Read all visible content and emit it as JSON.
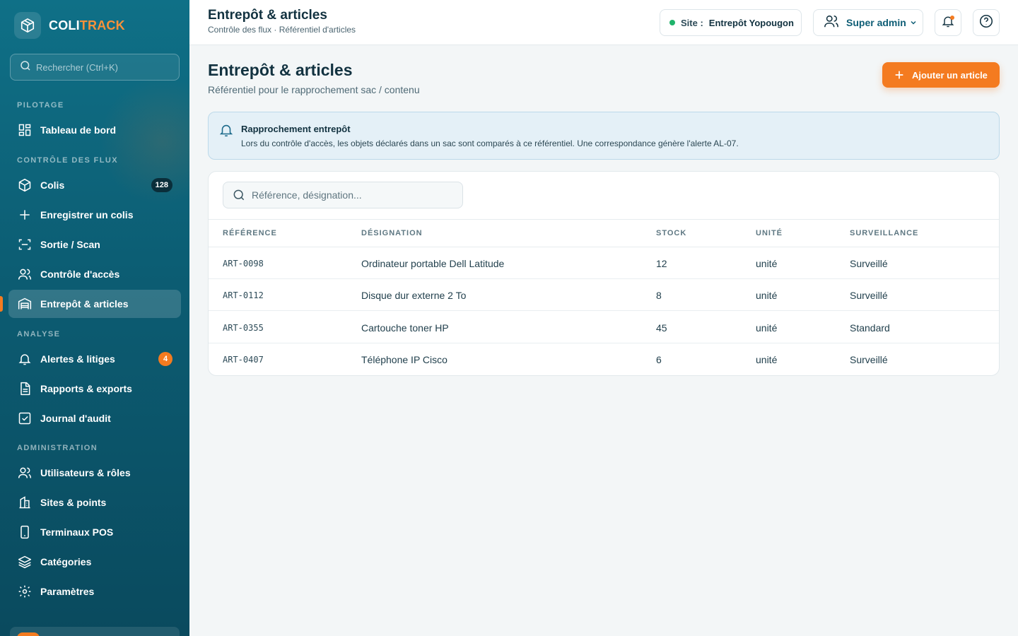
{
  "brand": {
    "name_part1": "COLI",
    "name_part2": "TRACK",
    "accent": "#f47b20"
  },
  "sidebar": {
    "search_placeholder": "Rechercher (Ctrl+K)",
    "sections": [
      "PILOTAGE",
      "CONTRÔLE DES FLUX",
      "ANALYSE",
      "ADMINISTRATION"
    ],
    "items": [
      {
        "label": "Tableau de bord",
        "icon": "dashboard-icon"
      },
      {
        "label": "Colis",
        "icon": "package-icon",
        "badge": "128"
      },
      {
        "label": "Enregistrer un colis",
        "icon": "plus-icon"
      },
      {
        "label": "Sortie / Scan",
        "icon": "scan-icon"
      },
      {
        "label": "Contrôle d'accès",
        "icon": "users-icon"
      },
      {
        "label": "Entrepôt & articles",
        "icon": "warehouse-icon",
        "active": true
      },
      {
        "label": "Alertes & litiges",
        "icon": "bell-icon",
        "badge": "4"
      },
      {
        "label": "Rapports & exports",
        "icon": "document-icon"
      },
      {
        "label": "Journal d'audit",
        "icon": "checklist-icon"
      },
      {
        "label": "Utilisateurs & rôles",
        "icon": "users-icon"
      },
      {
        "label": "Sites & points",
        "icon": "building-icon"
      },
      {
        "label": "Terminaux POS",
        "icon": "device-icon"
      },
      {
        "label": "Catégories",
        "icon": "layers-icon"
      },
      {
        "label": "Paramètres",
        "icon": "gear-icon"
      }
    ]
  },
  "topbar": {
    "title": "Entrepôt & articles",
    "breadcrumb": "Contrôle des flux · Référentiel d'articles",
    "site_label": "Site :",
    "site_value": "Entrepôt Yopougon",
    "user_name": "Super admin"
  },
  "main": {
    "title": "Entrepôt & articles",
    "subtitle": "Référentiel pour le rapprochement sac / contenu",
    "add_button": "Ajouter un article",
    "alert": {
      "title": "Rapprochement entrepôt",
      "text": "Lors du contrôle d'accès, les objets déclarés dans un sac sont comparés à ce référentiel. Une correspondance génère l'alerte AL-07."
    },
    "table": {
      "search_placeholder": "Référence, désignation...",
      "columns": [
        "RÉFÉRENCE",
        "DÉSIGNATION",
        "STOCK",
        "UNITÉ",
        "SURVEILLANCE"
      ],
      "rows": [
        [
          "ART-0098",
          "Ordinateur portable Dell Latitude",
          "12",
          "unité",
          "Surveillé"
        ],
        [
          "ART-0112",
          "Disque dur externe 2 To",
          "8",
          "unité",
          "Surveillé"
        ],
        [
          "ART-0355",
          "Cartouche toner HP",
          "45",
          "unité",
          "Standard"
        ],
        [
          "ART-0407",
          "Téléphone IP Cisco",
          "6",
          "unité",
          "Surveillé"
        ]
      ]
    }
  }
}
